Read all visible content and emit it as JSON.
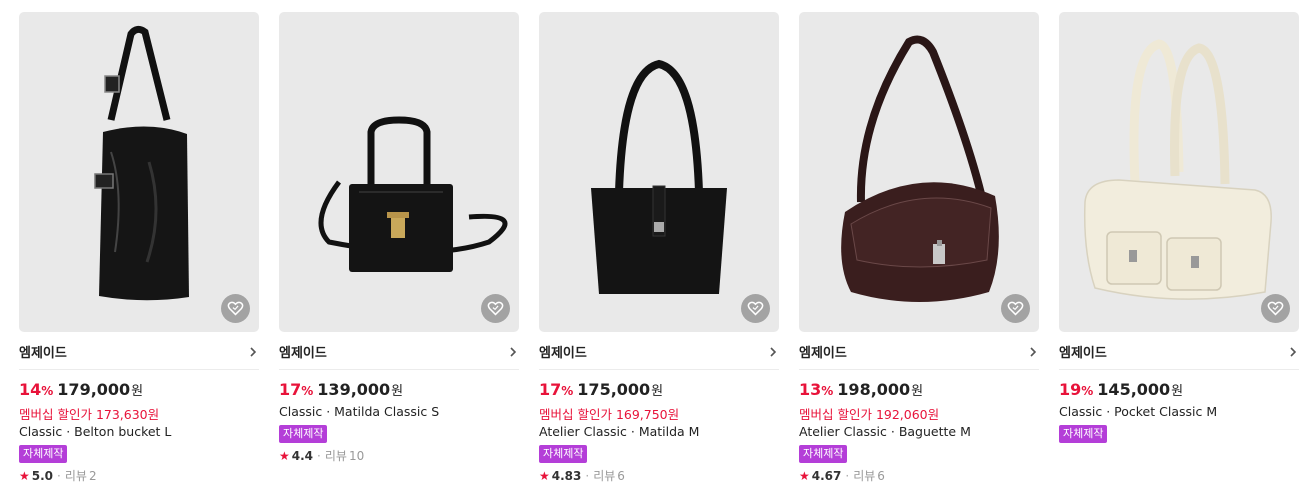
{
  "currency_suffix": "원",
  "percent_suffix": "%",
  "review_label": "리뷰",
  "products": [
    {
      "brand": "엠제이드",
      "discount": "14",
      "price": "179,000",
      "member_price": "멤버십 할인가 173,630원",
      "name": "Classic · Belton bucket L",
      "badge": "자체제작",
      "rating": "5.0",
      "review_count": "2"
    },
    {
      "brand": "엠제이드",
      "discount": "17",
      "price": "139,000",
      "member_price": "",
      "name": "Classic · Matilda Classic S",
      "badge": "자체제작",
      "rating": "4.4",
      "review_count": "10"
    },
    {
      "brand": "엠제이드",
      "discount": "17",
      "price": "175,000",
      "member_price": "멤버십 할인가 169,750원",
      "name": "Atelier Classic · Matilda M",
      "badge": "자체제작",
      "rating": "4.83",
      "review_count": "6"
    },
    {
      "brand": "엠제이드",
      "discount": "13",
      "price": "198,000",
      "member_price": "멤버십 할인가 192,060원",
      "name": "Atelier Classic · Baguette M",
      "badge": "자체제작",
      "rating": "4.67",
      "review_count": "6"
    },
    {
      "brand": "엠제이드",
      "discount": "19",
      "price": "145,000",
      "member_price": "",
      "name": "Classic · Pocket Classic M",
      "badge": "자체제작",
      "rating": "",
      "review_count": ""
    }
  ],
  "colors": {
    "accent": "#e8133a",
    "badge": "#b43ed8",
    "thumb_bg": "#e9e9e9"
  }
}
